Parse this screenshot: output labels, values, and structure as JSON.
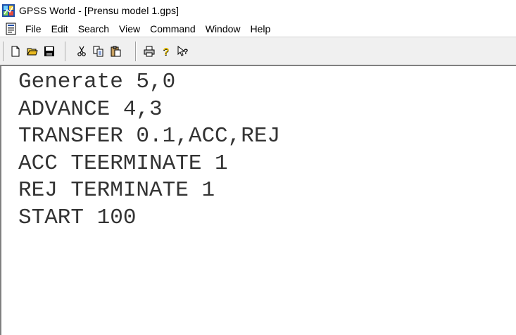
{
  "window": {
    "title": "GPSS World - [Prensu model 1.gps]"
  },
  "menu": {
    "items": [
      "File",
      "Edit",
      "Search",
      "View",
      "Command",
      "Window",
      "Help"
    ]
  },
  "toolbar": {
    "buttons": [
      "new-file-icon",
      "open-folder-icon",
      "save-icon",
      "cut-icon",
      "copy-icon",
      "paste-icon",
      "print-icon",
      "help-icon",
      "context-help-icon"
    ]
  },
  "editor": {
    "lines": [
      "Generate 5,0",
      "ADVANCE 4,3",
      "TRANSFER 0.1,ACC,REJ",
      "ACC TEERMINATE 1",
      "REJ TERMINATE 1",
      "START 100"
    ]
  }
}
